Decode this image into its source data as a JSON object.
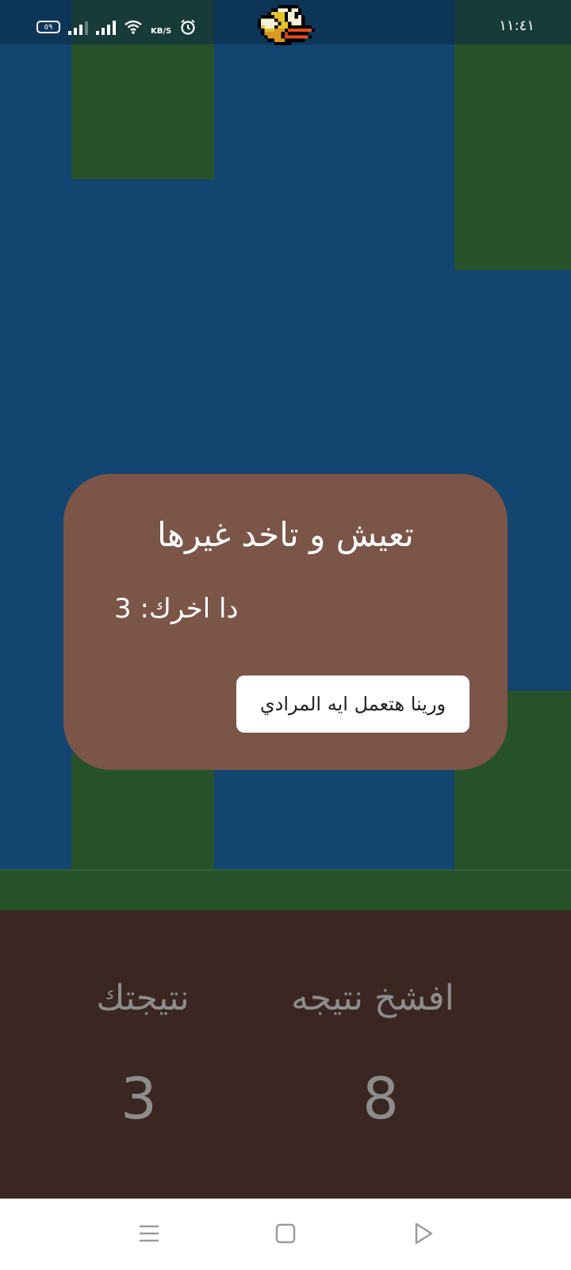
{
  "status_bar": {
    "battery": "٥٩",
    "network_speed": "KB/S",
    "time": "١١:٤١"
  },
  "game": {
    "character": "bird-sprite"
  },
  "dialog": {
    "title": "تعيش و تاخد غيرها",
    "message": "دا اخرك: 3",
    "button_label": "ورينا هتعمل ايه المرادي"
  },
  "scores": {
    "best_label": "افشخ نتيجه",
    "best_value": "8",
    "current_label": "نتيجتك",
    "current_value": "3"
  },
  "nav": {
    "items": [
      "menu-icon",
      "home-icon",
      "back-icon"
    ]
  },
  "colors": {
    "sky": "#12456f",
    "pipe": "#265229",
    "dialog": "#7b5548",
    "score_panel": "#3a2722"
  }
}
